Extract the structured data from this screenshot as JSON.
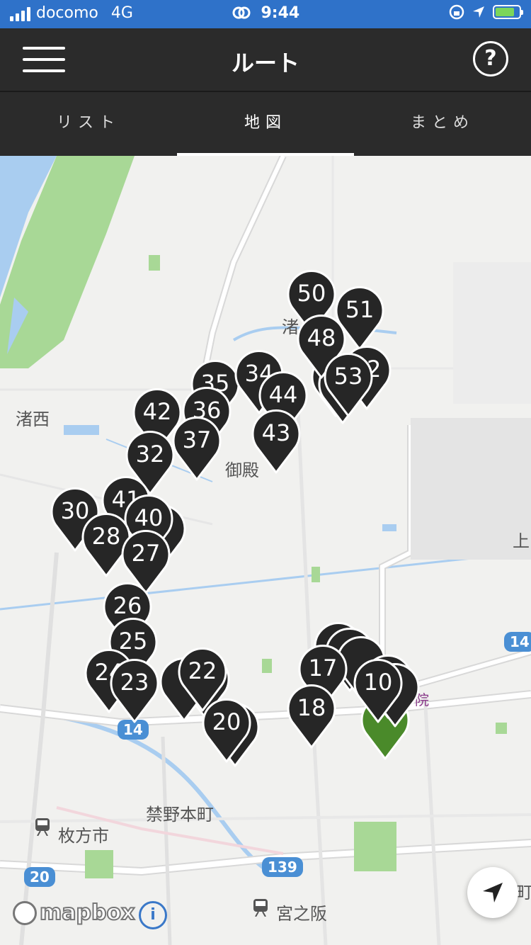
{
  "status_bar": {
    "carrier": "docomo",
    "network": "4G",
    "time": "9:44",
    "battery_level": 0.8
  },
  "nav": {
    "title": "ルート",
    "help_label": "?"
  },
  "tabs": [
    {
      "label": "リスト",
      "active": false
    },
    {
      "label": "地図",
      "active": true
    },
    {
      "label": "まとめ",
      "active": false
    }
  ],
  "map": {
    "places": [
      "渚西",
      "御殿",
      "禁野本町",
      "枚方市",
      "宮之阪",
      "院",
      "上",
      "町",
      "渚"
    ],
    "route_shields": [
      "14",
      "20",
      "139",
      "14"
    ],
    "pins": [
      {
        "label": "50"
      },
      {
        "label": "51"
      },
      {
        "label": "48"
      },
      {
        "label": "52"
      },
      {
        "label": "53"
      },
      {
        "label": "35"
      },
      {
        "label": "34"
      },
      {
        "label": "44"
      },
      {
        "label": "43"
      },
      {
        "label": "36"
      },
      {
        "label": "42"
      },
      {
        "label": "37"
      },
      {
        "label": "32"
      },
      {
        "label": "41"
      },
      {
        "label": "30"
      },
      {
        "label": "40"
      },
      {
        "label": "28"
      },
      {
        "label": "27"
      },
      {
        "label": "26"
      },
      {
        "label": "25"
      },
      {
        "label": "24"
      },
      {
        "label": "23"
      },
      {
        "label": "22"
      },
      {
        "label": "20"
      },
      {
        "label": "17"
      },
      {
        "label": "18"
      },
      {
        "label": "10"
      }
    ],
    "attribution": "mapbox",
    "info_label": "i",
    "colors": {
      "pin": "#262626",
      "pin_border": "#ffffff",
      "start_pin": "#4a8a2a",
      "water": "#a9cdf0",
      "park": "#a8d896",
      "road": "#ffffff"
    }
  }
}
